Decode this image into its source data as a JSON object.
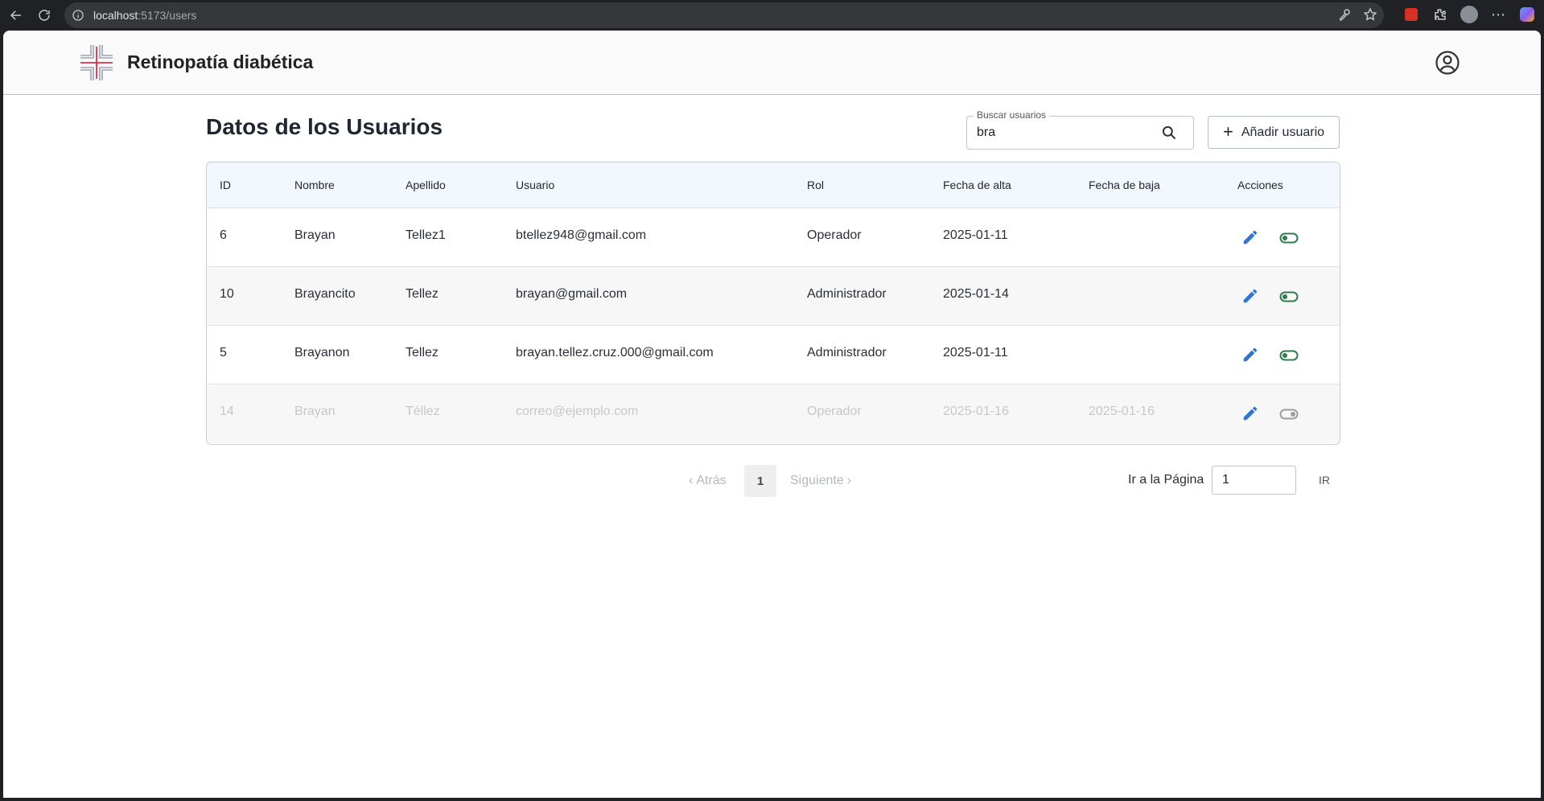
{
  "browser": {
    "url_host": "localhost",
    "url_path": ":5173/users"
  },
  "app": {
    "title": "Retinopatía diabética"
  },
  "page": {
    "title": "Datos de los Usuarios"
  },
  "search": {
    "label": "Buscar usuarios",
    "value": "bra"
  },
  "add_button": {
    "label": "Añadir usuario"
  },
  "table": {
    "headers": {
      "id": "ID",
      "nombre": "Nombre",
      "apellido": "Apellido",
      "usuario": "Usuario",
      "rol": "Rol",
      "fecha_alta": "Fecha de alta",
      "fecha_baja": "Fecha de baja",
      "acciones": "Acciones"
    },
    "rows": [
      {
        "id": "6",
        "nombre": "Brayan",
        "apellido": "Tellez1",
        "usuario": "btellez948@gmail.com",
        "rol": "Operador",
        "fecha_alta": "2025-01-11",
        "fecha_baja": "",
        "active": true
      },
      {
        "id": "10",
        "nombre": "Brayancito",
        "apellido": "Tellez",
        "usuario": "brayan@gmail.com",
        "rol": "Administrador",
        "fecha_alta": "2025-01-14",
        "fecha_baja": "",
        "active": true
      },
      {
        "id": "5",
        "nombre": "Brayanon",
        "apellido": "Tellez",
        "usuario": "brayan.tellez.cruz.000@gmail.com",
        "rol": "Administrador",
        "fecha_alta": "2025-01-11",
        "fecha_baja": "",
        "active": true
      },
      {
        "id": "14",
        "nombre": "Brayan",
        "apellido": "Téllez",
        "usuario": "correo@ejemplo.com",
        "rol": "Operador",
        "fecha_alta": "2025-01-16",
        "fecha_baja": "2025-01-16",
        "active": false
      }
    ]
  },
  "pagination": {
    "prev_label": "Atrás",
    "current_page": "1",
    "next_label": "Siguiente",
    "goto_label": "Ir a la Página",
    "goto_value": "1",
    "goto_button": "IR"
  },
  "colors": {
    "edit_icon": "#2f74d0",
    "toggle_active": "#2e7d4f",
    "toggle_inactive": "#9e9e9e"
  }
}
